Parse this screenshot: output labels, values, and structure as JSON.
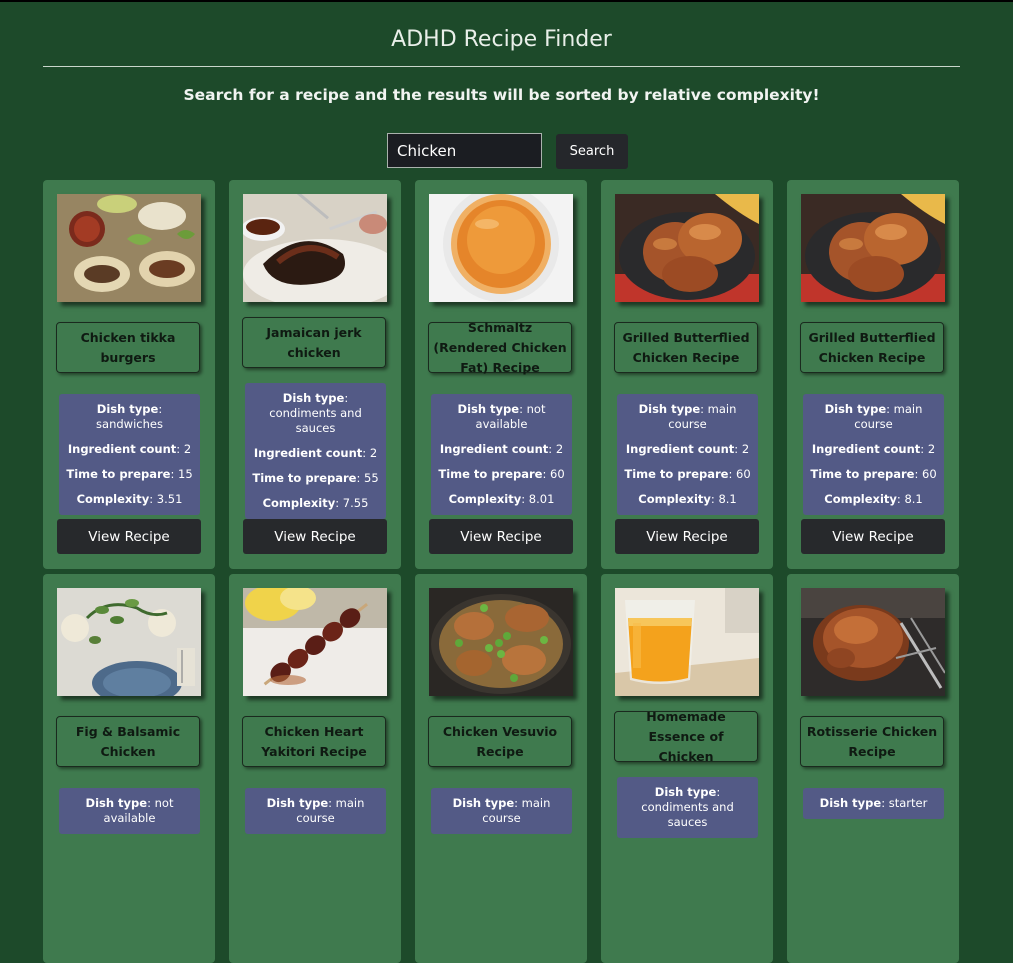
{
  "app": {
    "title": "ADHD Recipe Finder",
    "subtitle": "Search for a recipe and the results will be sorted by relative complexity!"
  },
  "search": {
    "value": "Chicken",
    "button_label": "Search"
  },
  "labels": {
    "dish_type": "Dish type",
    "ingredient_count": "Ingredient count",
    "time_to_prepare": "Time to prepare",
    "complexity": "Complexity",
    "view_recipe": "View Recipe"
  },
  "recipes": [
    {
      "title": "Chicken tikka burgers",
      "dish_type": "sandwiches",
      "ingredient_count": "2",
      "time_to_prepare": "15",
      "complexity": "3.51",
      "image": "tikka-burgers-photo"
    },
    {
      "title": "Jamaican jerk chicken",
      "dish_type": "condiments and sauces",
      "ingredient_count": "2",
      "time_to_prepare": "55",
      "complexity": "7.55",
      "image": "jerk-chicken-photo"
    },
    {
      "title": "Schmaltz (Rendered Chicken Fat) Recipe",
      "dish_type": "not available",
      "ingredient_count": "2",
      "time_to_prepare": "60",
      "complexity": "8.01",
      "image": "schmaltz-bowl-photo"
    },
    {
      "title": "Grilled Butterflied Chicken Recipe",
      "dish_type": "main course",
      "ingredient_count": "2",
      "time_to_prepare": "60",
      "complexity": "8.1",
      "image": "grilled-chicken-photo"
    },
    {
      "title": "Grilled Butterflied Chicken Recipe",
      "dish_type": "main course",
      "ingredient_count": "2",
      "time_to_prepare": "60",
      "complexity": "8.1",
      "image": "grilled-chicken-photo"
    },
    {
      "title": "Fig & Balsamic Chicken",
      "dish_type": "not available",
      "image": "fig-table-photo"
    },
    {
      "title": "Chicken Heart Yakitori Recipe",
      "dish_type": "main course",
      "image": "yakitori-skewer-photo"
    },
    {
      "title": "Chicken Vesuvio Recipe",
      "dish_type": "main course",
      "image": "vesuvio-pan-photo"
    },
    {
      "title": "Homemade Essence of Chicken",
      "dish_type": "condiments and sauces",
      "image": "essence-glass-photo"
    },
    {
      "title": "Rotisserie Chicken Recipe",
      "dish_type": "starter",
      "image": "rotisserie-photo"
    }
  ],
  "colors": {
    "background": "#1d4a2a",
    "card": "#3f7a4e",
    "info_panel": "#535a86",
    "button": "#27292c"
  }
}
